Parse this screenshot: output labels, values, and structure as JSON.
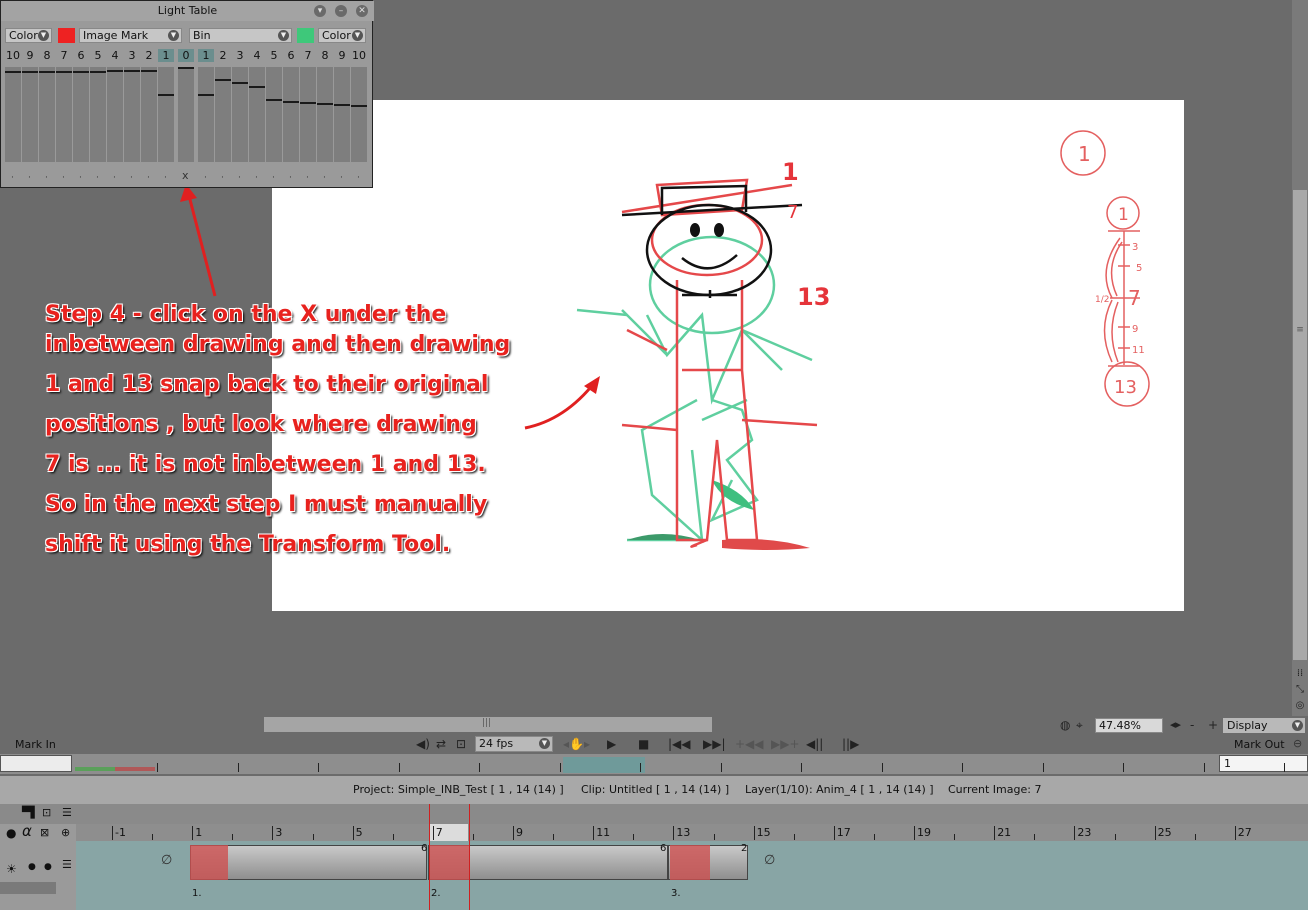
{
  "light_table": {
    "title": "Light Table",
    "left_mode": "Color",
    "left_color": "#ee2222",
    "left_mark": "Image Mark",
    "right_bin": "Bin",
    "right_color": "#3ec87a",
    "right_mode": "Color",
    "left_numbers": [
      "10",
      "9",
      "8",
      "7",
      "6",
      "5",
      "4",
      "3",
      "2",
      "1"
    ],
    "center_number": "0",
    "right_numbers": [
      "1",
      "2",
      "3",
      "4",
      "5",
      "6",
      "7",
      "8",
      "9",
      "10"
    ],
    "reset_mark": "x"
  },
  "annotation": {
    "lines": [
      "Step 4 -  click on the X under the",
      "inbetween drawing and then drawing",
      "1 and 13 snap back to their original",
      "positions , but look where drawing",
      "7 is ... it is not inbetween 1 and 13.",
      "So in the next step I must manually",
      "shift it using the Transform Tool."
    ]
  },
  "canvas_labels": {
    "frame_1": "1",
    "frame_7": "7",
    "frame_13": "13",
    "chart_top": "1",
    "chart_mid": "7",
    "chart_bottom": "13",
    "chart_small": [
      "3",
      "5",
      "9",
      "11"
    ],
    "chart_half": "1/2"
  },
  "view": {
    "zoom": "47.48%",
    "display": "Display",
    "minus": "-",
    "plus": "+"
  },
  "transport": {
    "mark_in": "Mark In",
    "mark_out": "Mark Out",
    "fps": "24 fps",
    "mark_out_value": "1"
  },
  "info": {
    "project": "Project: Simple_INB_Test [ 1 , 14  (14) ]",
    "clip": "Clip: Untitled [ 1 , 14  (14) ]",
    "layer": "Layer(1/10): Anim_4 [ 1 , 14  (14) ]",
    "current_image": "Current Image: 7"
  },
  "timeline": {
    "ruler": [
      "-1",
      "1",
      "3",
      "5",
      "7",
      "9",
      "11",
      "13",
      "15",
      "17",
      "19",
      "21",
      "23",
      "25",
      "27"
    ],
    "current_frame": "7",
    "clip_labels": [
      "1.",
      "2.",
      "3."
    ],
    "hold_labels": [
      "6",
      "6",
      "2"
    ]
  }
}
